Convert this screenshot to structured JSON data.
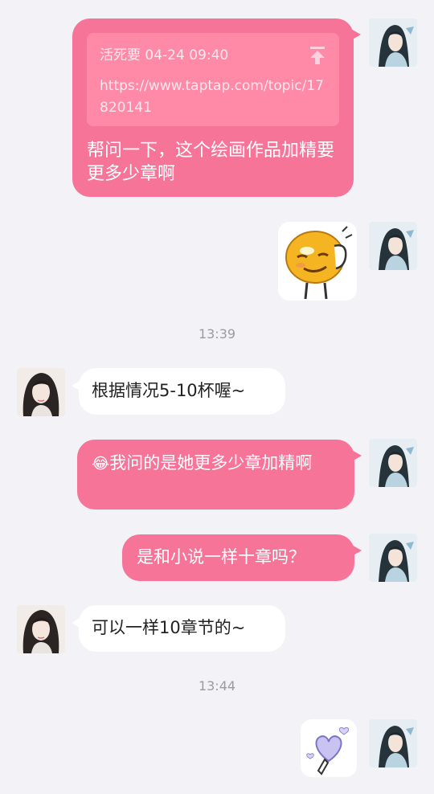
{
  "messages": {
    "m1": {
      "link_meta": "活死要 04-24 09:40",
      "link_url": "https://www.taptap.com/topic/17820141",
      "text": "帮问一下，这个绘画作品加精要更多少章啊"
    },
    "m3_text": "根据情况5-10杯喔~",
    "m4_emoji": "😂",
    "m4_text": "我问的是她更多少章加精啊",
    "m5_text": "是和小说一样十章吗？",
    "m6_text": "可以一样10章节的~"
  },
  "timestamps": [
    "13:39",
    "13:44"
  ],
  "icons": {
    "pin": "pin-top-icon",
    "sticker1": "smiley-thinking-sticker",
    "sticker2": "heart-hand-sticker"
  },
  "colors": {
    "outgoing_bubble": "#f77499",
    "incoming_bubble": "#ffffff",
    "background": "#f3f3f7"
  }
}
